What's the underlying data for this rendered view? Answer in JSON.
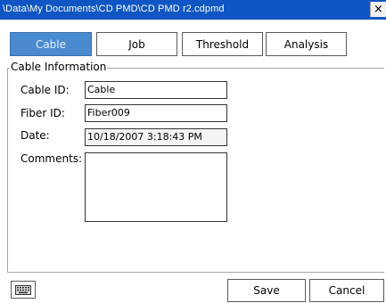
{
  "window": {
    "title": "\\Data\\My Documents\\CD PMD\\CD PMD r2.cdpmd",
    "close_label": "×"
  },
  "tabs": [
    {
      "label": "Cable",
      "active": true
    },
    {
      "label": "Job",
      "active": false
    },
    {
      "label": "Threshold",
      "active": false
    },
    {
      "label": "Analysis",
      "active": false
    }
  ],
  "cable_info": {
    "group_label": "Cable Information",
    "cable_id_label": "Cable ID:",
    "cable_id_value": "Cable",
    "fiber_id_label": "Fiber ID:",
    "fiber_id_value": "Fiber009",
    "date_label": "Date:",
    "date_value": "10/18/2007 3:18:43 PM",
    "comments_label": "Comments:",
    "comments_value": ""
  },
  "footer": {
    "keyboard_icon": "keyboard-icon",
    "save_label": "Save",
    "cancel_label": "Cancel"
  },
  "colors": {
    "titlebar": "#0f56c4",
    "active_tab": "#4a8bd0"
  }
}
